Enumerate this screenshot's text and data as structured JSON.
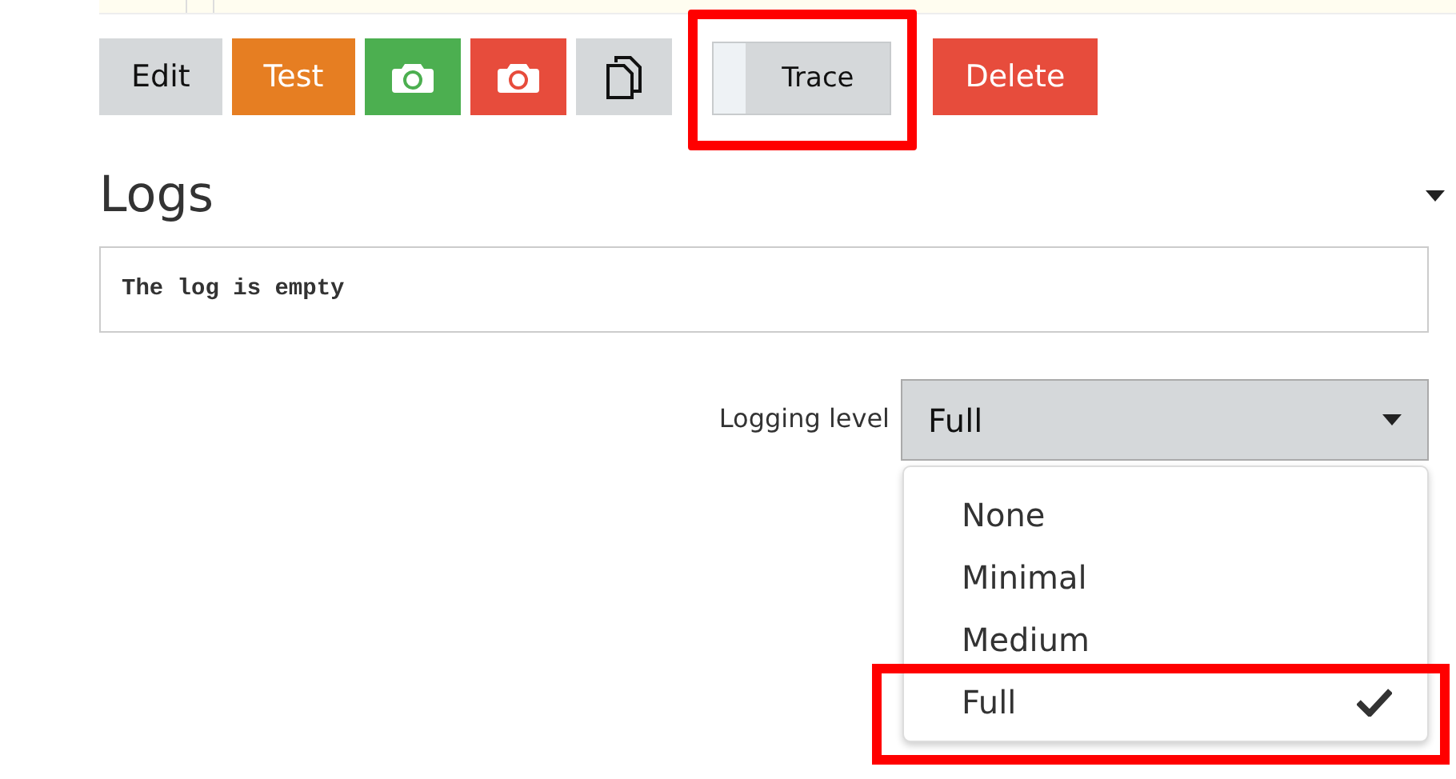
{
  "buttons": [
    {
      "kind": "text",
      "label": "Edit",
      "color": "#d5d8da"
    },
    {
      "kind": "text",
      "label": "Test",
      "color": "#e67e22"
    },
    {
      "kind": "camera",
      "color": "#4caf50"
    },
    {
      "kind": "camera",
      "color": "#e74c3c"
    },
    {
      "kind": "copy",
      "color": "#d5d8da"
    },
    {
      "kind": "toggle",
      "label": "Trace",
      "on": false,
      "highlighted": true,
      "color": "#d5d8da"
    },
    {
      "kind": "text",
      "label": "Delete",
      "color": "#e74c3c"
    }
  ],
  "logs": {
    "title": "Logs",
    "expanded": true,
    "message": "The log is empty"
  },
  "logging_level": {
    "label": "Logging level",
    "value": "Full",
    "open": true,
    "options": [
      {
        "label": "None",
        "selected": false,
        "highlighted": false
      },
      {
        "label": "Minimal",
        "selected": false,
        "highlighted": false
      },
      {
        "label": "Medium",
        "selected": false,
        "highlighted": false
      },
      {
        "label": "Full",
        "selected": true,
        "highlighted": true
      }
    ]
  }
}
